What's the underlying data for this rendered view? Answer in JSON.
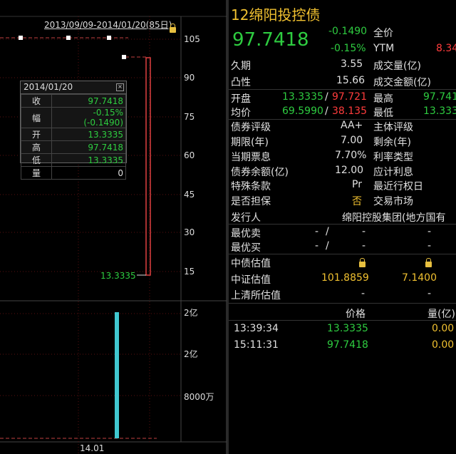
{
  "chart": {
    "range_label": "2013/09/09-2014/01/20(85日)",
    "price_ticks": [
      "105",
      "90",
      "75",
      "60",
      "45",
      "30",
      "15"
    ],
    "volume_ticks": [
      "2亿",
      "2亿",
      "8000万"
    ],
    "x_label": "14.01",
    "low_label": "13.3335",
    "tooltip": {
      "date": "2014/01/20",
      "rows": [
        {
          "k": "收",
          "v": "97.7418"
        },
        {
          "k": "幅",
          "v": "-0.15%(-0.1490)"
        },
        {
          "k": "开",
          "v": "13.3335"
        },
        {
          "k": "高",
          "v": "97.7418"
        },
        {
          "k": "低",
          "v": "13.3335"
        },
        {
          "k": "量",
          "v": "0"
        }
      ]
    }
  },
  "chart_data": {
    "type": "candlestick",
    "x_range": "2013/09/09-2014/01/20",
    "y_ticks": [
      105,
      90,
      75,
      60,
      45,
      30,
      15
    ],
    "candle": {
      "date": "2014/01/20",
      "open": 13.3335,
      "high": 97.7418,
      "low": 13.3335,
      "close": 97.7418
    },
    "reference_lines": [
      {
        "value": 105
      },
      {
        "value": 97.7418
      }
    ],
    "volume_bar": {
      "date": "2014/01/20"
    }
  },
  "quote": {
    "title": "12绵阳投控债",
    "price": "97.7418",
    "change": "-0.1490",
    "change_pct": "-0.15%",
    "full_price_label": "全价",
    "ytm_label": "YTM",
    "ytm_value": "8.34",
    "duration_label": "久期",
    "duration_value": "3.55",
    "convexity_label": "凸性",
    "convexity_value": "15.66",
    "volume_label": "成交量(亿)",
    "amount_label": "成交金额(亿)",
    "open_label": "开盘",
    "open_value": "13.3335",
    "open_value2": "97.721",
    "high_label": "最高",
    "high_value": "97.741",
    "avg_label": "均价",
    "avg_value": "69.5990",
    "avg_value2": "38.135",
    "low_label": "最低",
    "low_value": "13.333",
    "sep": "/"
  },
  "info": {
    "rows": [
      {
        "l": "债券评级",
        "v": "AA+",
        "l2": "主体评级"
      },
      {
        "l": "期限(年)",
        "v": "7.00",
        "l2": "剩余(年)"
      },
      {
        "l": "当期票息",
        "v": "7.70%",
        "l2": "利率类型"
      },
      {
        "l": "债券余额(亿)",
        "v": "12.00",
        "l2": "应计利息"
      },
      {
        "l": "特殊条款",
        "v": "Pr",
        "l2": "最近行权日"
      },
      {
        "l": "是否担保",
        "v": "否",
        "l2": "交易市场"
      }
    ],
    "issuer_label": "发行人",
    "issuer_value": "绵阳控股集团(地方国有"
  },
  "best": {
    "sell_label": "最优卖",
    "buy_label": "最优买",
    "dash": "-",
    "slash": "/"
  },
  "valuation": {
    "zz_label": "中债估值",
    "csi_label": "中证估值",
    "csi_value": "101.8859",
    "csi_value2": "7.1400",
    "sh_label": "上清所估值",
    "dash": "-"
  },
  "trades": {
    "price_header": "价格",
    "qty_header": "量(亿)",
    "rows": [
      {
        "time": "13:39:34",
        "price": "13.3335",
        "qty": "0.00"
      },
      {
        "time": "15:11:31",
        "price": "97.7418",
        "qty": "0.00"
      }
    ]
  }
}
